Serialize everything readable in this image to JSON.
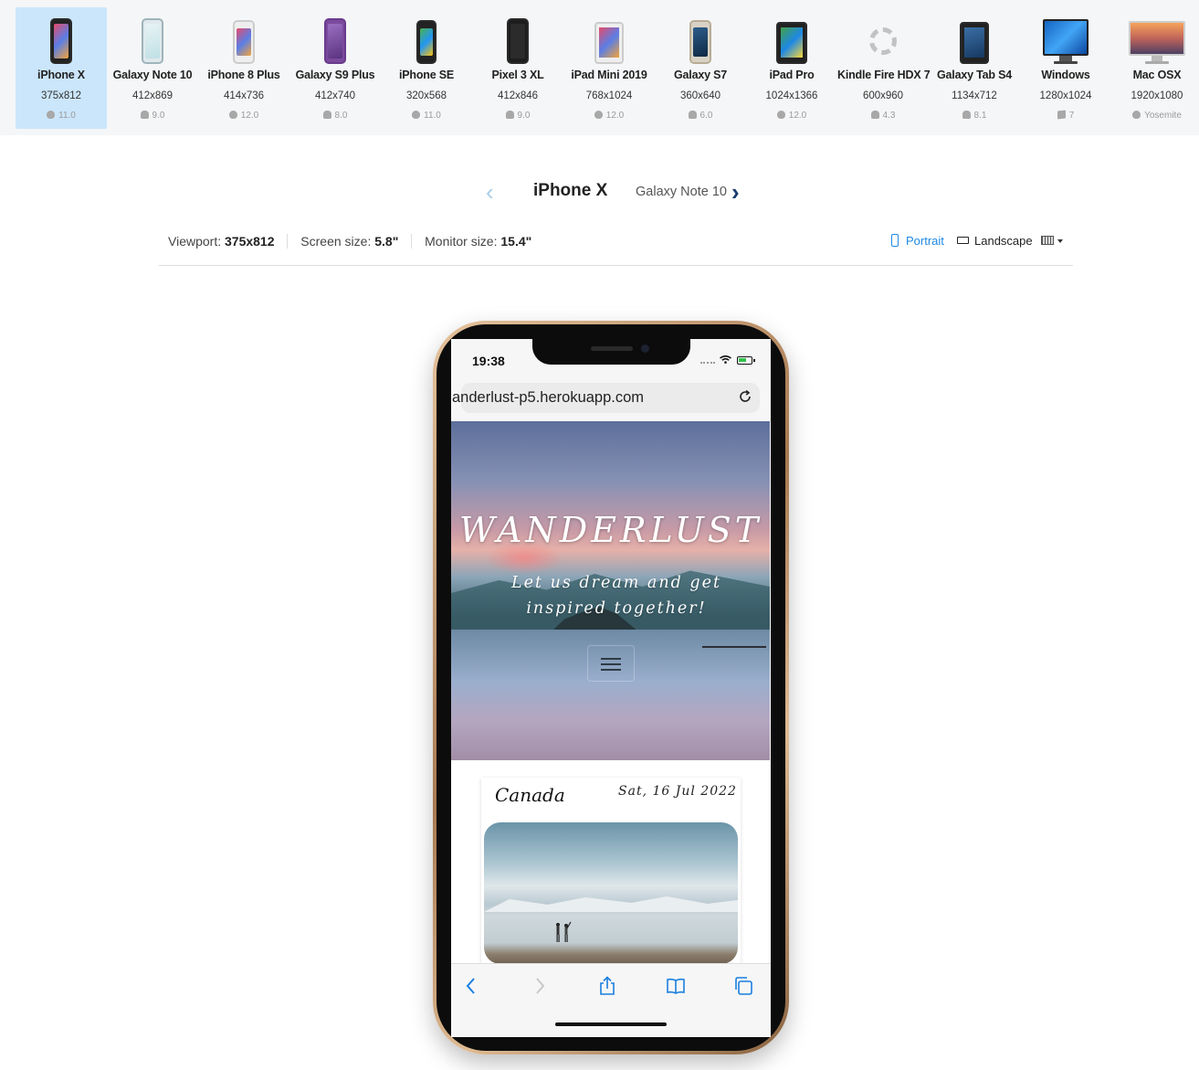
{
  "devices": [
    {
      "name": "iPhone X",
      "res": "375x812",
      "os": "11.0",
      "os_icon": "apple-icon",
      "active": true
    },
    {
      "name": "Galaxy Note 10",
      "res": "412x869",
      "os": "9.0",
      "os_icon": "android-icon"
    },
    {
      "name": "iPhone 8 Plus",
      "res": "414x736",
      "os": "12.0",
      "os_icon": "apple-icon"
    },
    {
      "name": "Galaxy S9 Plus",
      "res": "412x740",
      "os": "8.0",
      "os_icon": "android-icon"
    },
    {
      "name": "iPhone SE",
      "res": "320x568",
      "os": "11.0",
      "os_icon": "apple-icon"
    },
    {
      "name": "Pixel 3 XL",
      "res": "412x846",
      "os": "9.0",
      "os_icon": "android-icon"
    },
    {
      "name": "iPad Mini 2019",
      "res": "768x1024",
      "os": "12.0",
      "os_icon": "apple-icon"
    },
    {
      "name": "Galaxy S7",
      "res": "360x640",
      "os": "6.0",
      "os_icon": "android-icon"
    },
    {
      "name": "iPad Pro",
      "res": "1024x1366",
      "os": "12.0",
      "os_icon": "apple-icon"
    },
    {
      "name": "Kindle Fire HDX 7",
      "res": "600x960",
      "os": "4.3",
      "os_icon": "android-icon"
    },
    {
      "name": "Galaxy Tab S4",
      "res": "1134x712",
      "os": "8.1",
      "os_icon": "android-icon"
    },
    {
      "name": "Windows",
      "res": "1280x1024",
      "os": "7",
      "os_icon": "windows-icon"
    },
    {
      "name": "Mac OSX",
      "res": "1920x1080",
      "os": "Yosemite",
      "os_icon": "apple-icon"
    }
  ],
  "nav": {
    "prev_icon": "chevron-left-icon",
    "current": "iPhone X",
    "next": "Galaxy Note 10",
    "next_icon": "chevron-right-icon"
  },
  "info": {
    "viewport_label": "Viewport:",
    "viewport_value": "375x812",
    "screen_label": "Screen size:",
    "screen_value": "5.8\"",
    "monitor_label": "Monitor size:",
    "monitor_value": "15.4\""
  },
  "orientation": {
    "portrait": "Portrait",
    "landscape": "Landscape",
    "selected": "Portrait"
  },
  "colors": {
    "accent": "#1e88e5",
    "active_bg": "#cbe6fb",
    "strip_bg": "#f5f6f7",
    "frame_gold": "#c9a27a"
  },
  "phone": {
    "time": "19:38",
    "url": "anderlust-p5.herokuapp.com",
    "hero_title": "WANDERLUST",
    "hero_subtitle": "Let us dream and get inspired together!",
    "card": {
      "title": "Canada",
      "date": "Sat, 16 Jul 2022"
    }
  }
}
